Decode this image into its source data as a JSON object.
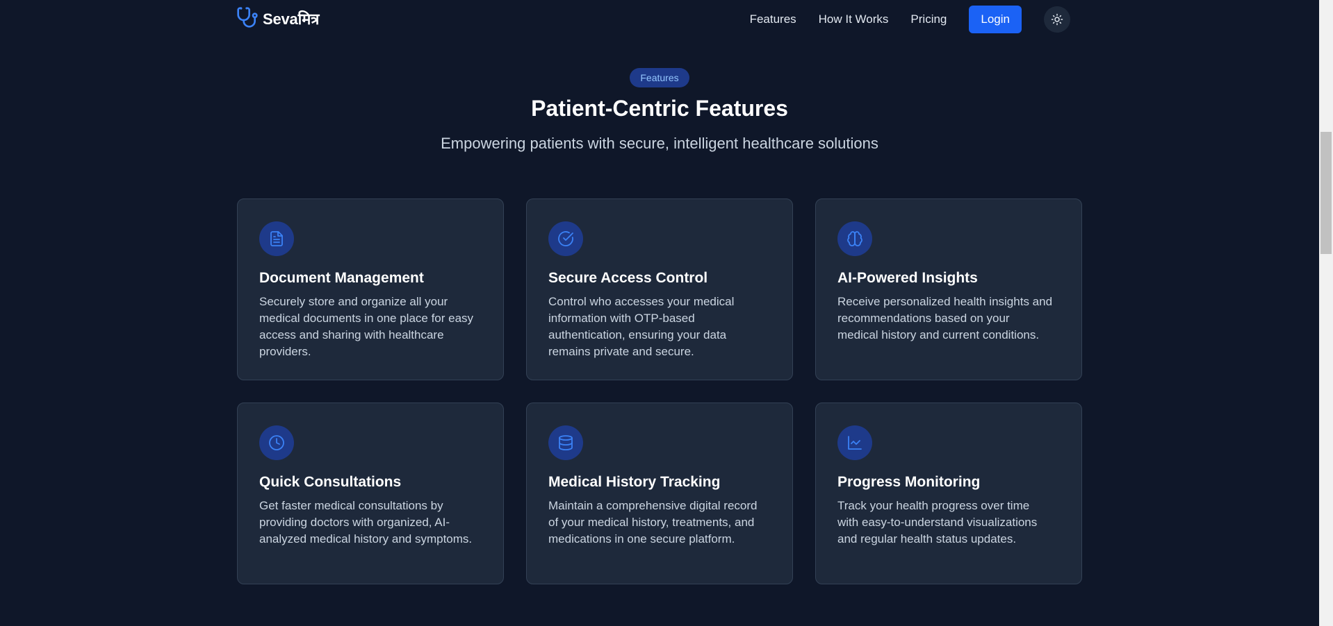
{
  "brand": {
    "name": "Sevaमित्र",
    "icon": "stethoscope-icon"
  },
  "nav": {
    "links": [
      "Features",
      "How It Works",
      "Pricing"
    ],
    "login_label": "Login",
    "theme_icon": "sun-icon"
  },
  "section": {
    "badge": "Features",
    "title": "Patient-Centric Features",
    "subtitle": "Empowering patients with secure, intelligent healthcare solutions"
  },
  "cards": [
    {
      "icon": "document-icon",
      "title": "Document Management",
      "description": "Securely store and organize all your medical documents in one place for easy access and sharing with healthcare providers."
    },
    {
      "icon": "check-circle-icon",
      "title": "Secure Access Control",
      "description": "Control who accesses your medical information with OTP-based authentication, ensuring your data remains private and secure."
    },
    {
      "icon": "brain-icon",
      "title": "AI-Powered Insights",
      "description": "Receive personalized health insights and recommendations based on your medical history and current conditions."
    },
    {
      "icon": "clock-icon",
      "title": "Quick Consultations",
      "description": "Get faster medical consultations by providing doctors with organized, AI-analyzed medical history and symptoms."
    },
    {
      "icon": "database-icon",
      "title": "Medical History Tracking",
      "description": "Maintain a comprehensive digital record of your medical history, treatments, and medications in one secure platform."
    },
    {
      "icon": "line-chart-icon",
      "title": "Progress Monitoring",
      "description": "Track your health progress over time with easy-to-understand visualizations and regular health status updates."
    }
  ],
  "colors": {
    "background": "#0f1729",
    "card": "#1e293b",
    "accent": "#1b62f5",
    "icon_blue": "#3b82f6",
    "badge_bg": "#1e3a8a"
  }
}
